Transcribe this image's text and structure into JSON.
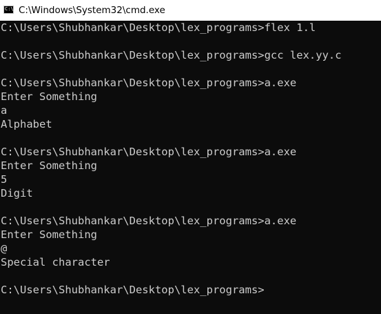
{
  "window": {
    "title": "C:\\Windows\\System32\\cmd.exe",
    "icon": "cmd-icon",
    "icon_glyph": "C:\\",
    "colors": {
      "background": "#0c0c0c",
      "text": "#cccccc",
      "titlebar": "#ffffff"
    }
  },
  "console": {
    "lines": [
      "C:\\Users\\Shubhankar\\Desktop\\lex_programs>flex 1.l",
      "",
      "C:\\Users\\Shubhankar\\Desktop\\lex_programs>gcc lex.yy.c",
      "",
      "C:\\Users\\Shubhankar\\Desktop\\lex_programs>a.exe",
      "Enter Something",
      "a",
      "Alphabet",
      "",
      "C:\\Users\\Shubhankar\\Desktop\\lex_programs>a.exe",
      "Enter Something",
      "5",
      "Digit",
      "",
      "C:\\Users\\Shubhankar\\Desktop\\lex_programs>a.exe",
      "Enter Something",
      "@",
      "Special character",
      "",
      "C:\\Users\\Shubhankar\\Desktop\\lex_programs>"
    ]
  }
}
